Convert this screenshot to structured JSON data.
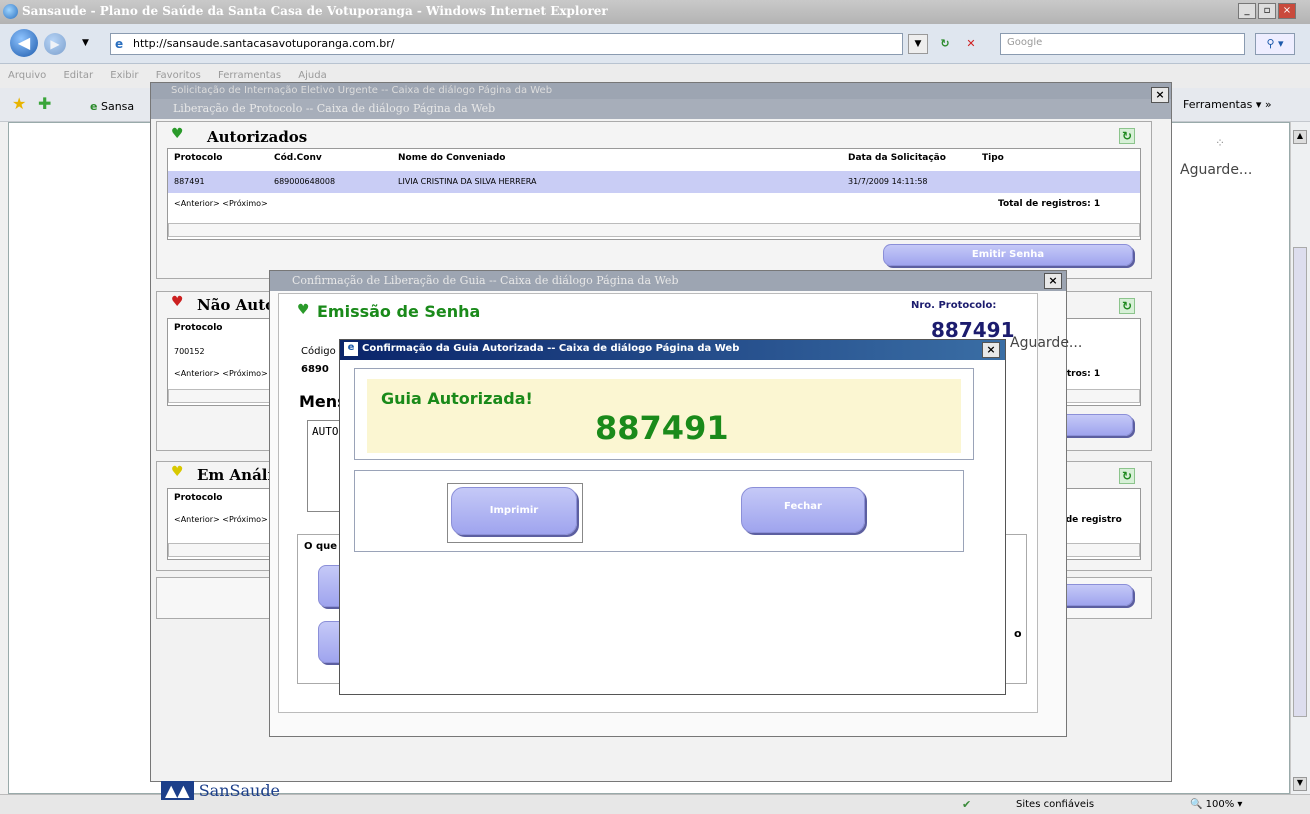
{
  "browser": {
    "title": "Sansaude - Plano de Saúde da Santa Casa de Votuporanga - Windows Internet Explorer",
    "url": "http://sansaude.santacasavotuporanga.com.br/",
    "search_placeholder": "Google",
    "menu": [
      "Arquivo",
      "Editar",
      "Exibir",
      "Favoritos",
      "Ferramentas",
      "Ajuda"
    ],
    "tab_label": "Sansa",
    "tools_label": "Ferramentas",
    "loading_text": "Aguarde...",
    "status_zone": "Sites confiáveis",
    "zoom": "100%"
  },
  "dialog1": {
    "title": "Liberação de Protocolo -- Caixa de diálogo Página da Web",
    "behind_title": "Solicitação de Internação Eletivo Urgente -- Caixa de diálogo Página da Web",
    "authorized": {
      "title": "Autorizados",
      "columns": [
        "Protocolo",
        "Cód.Conv",
        "Nome do Conveniado",
        "Data da Solicitação",
        "Tipo"
      ],
      "row": {
        "protocolo": "887491",
        "cod": "689000648008",
        "nome": "LIVIA CRISTINA DA SILVA HERRERA",
        "data": "31/7/2009 14:11:58",
        "tipo": ""
      },
      "pager": "<Anterior> <Próximo>",
      "total": "Total de registros: 1",
      "button": "Emitir Senha"
    },
    "denied": {
      "title": "Não Autorizados",
      "col": "Protocolo",
      "row": "700152",
      "pager": "<Anterior> <Próximo>",
      "total": "Total de registros: 1"
    },
    "analysis": {
      "title": "Em Análise",
      "col": "Protocolo",
      "pager": "<Anterior> <Próximo>",
      "total": "Total de registro"
    },
    "footer_logo": "SanSaude"
  },
  "dialog2": {
    "title": "Confirmação de Liberação de Guia -- Caixa de diálogo Página da Web",
    "heading": "Emissão de Senha",
    "protocol_label": "Nro. Protocolo:",
    "protocol_value": "887491",
    "code_label": "Código",
    "code_value": "6890",
    "msg_label": "Mensagem",
    "msg_value": "AUTORIZADO",
    "question": "O que",
    "right_letter": "o",
    "loading": "Aguarde..."
  },
  "dialog3": {
    "title": "Confirmação da Guia Autorizada -- Caixa de diálogo Página da Web",
    "message": "Guia Autorizada!",
    "number": "887491",
    "print_button": "Imprimir",
    "close_button": "Fechar"
  },
  "colors": {
    "green_text": "#1a8a1a",
    "navy": "#1c1c6e",
    "highlight_row": "#c9cdf5",
    "message_bg": "#fbf6d2"
  }
}
